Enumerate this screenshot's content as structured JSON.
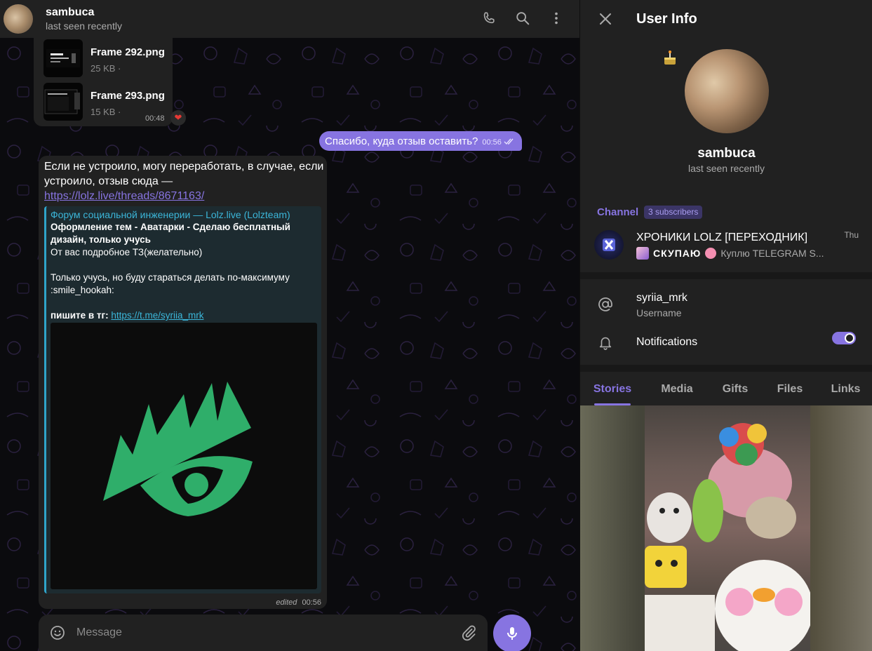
{
  "chat_header": {
    "name": "sambuca",
    "status": "last seen recently"
  },
  "messages": {
    "files": [
      {
        "name": "Frame 292.png",
        "size": "25 KB ·"
      },
      {
        "name": "Frame 293.png",
        "size": "15 KB ·"
      }
    ],
    "files_time": "00:48",
    "reaction": "❤",
    "outgoing_text": "Спасибо, куда отзыв оставить?",
    "outgoing_time": "00:56",
    "incoming_text": "Если не устроило, могу переработать, в случае, если устроило, отзыв сюда —",
    "incoming_link": "https://lolz.live/threads/8671163/",
    "preview": {
      "site": "Форум социальной инженерии — Lolz.live (Lolzteam)",
      "title": "Оформление тем - Аватарки - Сделаю бесплатный дизайн, только учусь",
      "desc1": "От вас подробное ТЗ(желательно)",
      "desc2": "Только учусь, но буду стараться делать по-максимуму :smile_hookah:",
      "tg_label": "пишите в тг:",
      "tg_link": "https://t.me/syriia_mrk"
    },
    "incoming_edited": "edited",
    "incoming_time": "00:56"
  },
  "composer": {
    "placeholder": "Message"
  },
  "panel": {
    "title": "User Info",
    "name": "sambuca",
    "status": "last seen recently",
    "channel_label": "Channel",
    "subscribers": "3 subscribers",
    "channel": {
      "title": "ХРОНИКИ LOLZ [ПЕРЕХОДНИК]",
      "date": "Thu",
      "sub_styled": "СКУПАЮ",
      "sub_text": "Куплю TELEGRAM S..."
    },
    "username": "syriia_mrk",
    "username_label": "Username",
    "notifications_label": "Notifications",
    "notifications_on": true,
    "tabs": [
      "Stories",
      "Media",
      "Gifts",
      "Files",
      "Links"
    ]
  },
  "colors": {
    "accent": "#8774e1",
    "link": "#3bb6d9",
    "logo_green": "#2fae6a"
  }
}
